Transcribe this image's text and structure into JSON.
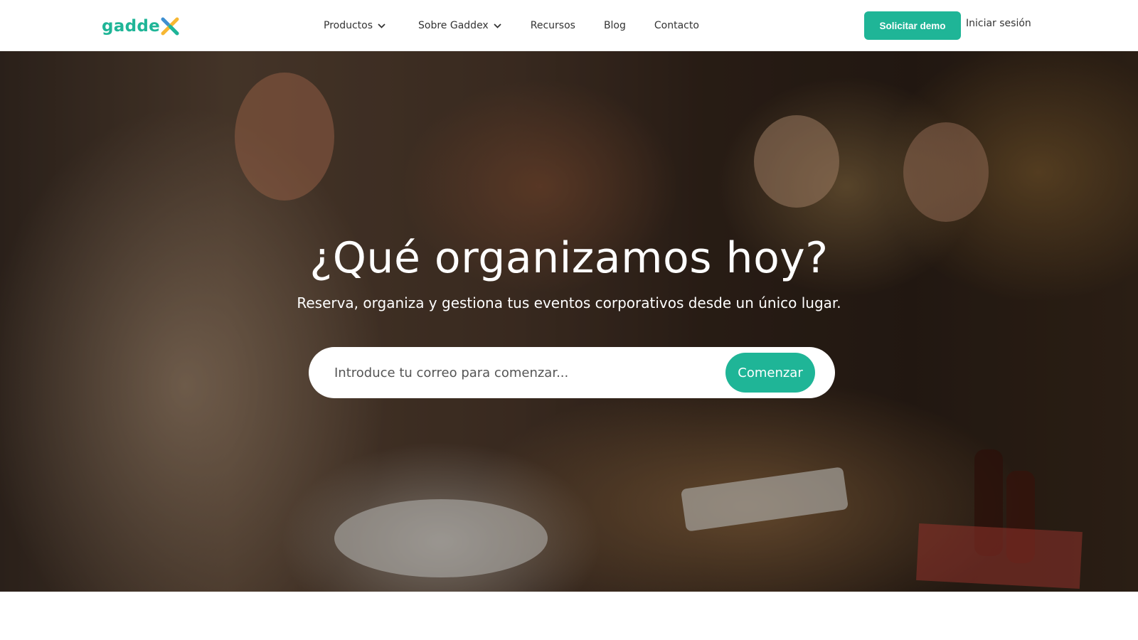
{
  "brand": {
    "name": "gadde",
    "accent_color": "#1fb597",
    "logo_x_colors": [
      "#f7b733",
      "#3d8fd1",
      "#1fb597"
    ]
  },
  "nav": {
    "items": [
      {
        "label": "Productos",
        "has_dropdown": true
      },
      {
        "label": "Sobre Gaddex",
        "has_dropdown": true
      },
      {
        "label": "Recursos",
        "has_dropdown": false
      },
      {
        "label": "Blog",
        "has_dropdown": false
      },
      {
        "label": "Contacto",
        "has_dropdown": false
      }
    ],
    "dropdown_icon": "chevron-down-icon"
  },
  "header_actions": {
    "demo_label": "Solicitar demo",
    "login_label": "Iniciar sesión"
  },
  "hero": {
    "title": "¿Qué organizamos hoy?",
    "subtitle": "Reserva, organiza y gestiona tus eventos corporativos desde un único lugar.",
    "email_placeholder": "Introduce tu correo para comenzar...",
    "email_value": "",
    "cta_label": "Comenzar",
    "background_image": "restaurant-dinner-photo"
  }
}
